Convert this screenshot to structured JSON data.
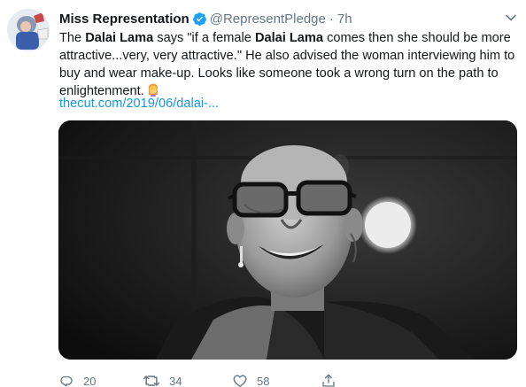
{
  "tweet": {
    "display_name": "Miss Representation",
    "verified_icon": "verified-badge-icon",
    "handle": "@RepresentPledge",
    "separator": "·",
    "time": "7h",
    "text": {
      "p1": "The ",
      "b1": "Dalai Lama",
      "p2": " says \"if a female ",
      "b2": "Dalai Lama",
      "p3": " comes then she should be more attractive...very, very attractive.\" He also advised the woman interviewing him to buy and wear make-up. Looks like someone took a wrong turn on the path to enlightenment.",
      "emoji": "woman-facepalming-emoji"
    },
    "link": "thecut.com/2019/06/dalai-...",
    "media_alt": "black-and-white photo of a smiling monk with glasses"
  },
  "actions": {
    "reply_count": "20",
    "retweet_count": "34",
    "like_count": "58"
  },
  "colors": {
    "text": "#14171a",
    "secondary": "#657786",
    "link": "#1b95e0",
    "verified": "#1da1f2"
  }
}
